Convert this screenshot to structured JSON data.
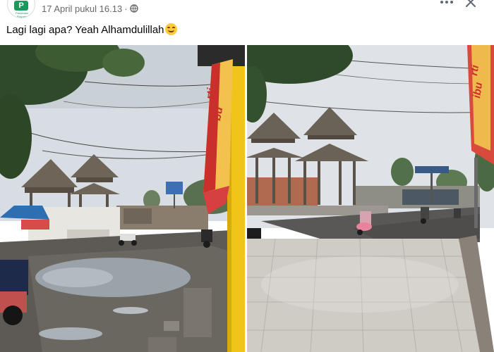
{
  "post": {
    "page_logo_text": "P",
    "page_logo_caption": "Pasundan Ekspres",
    "timestamp": "17 April pukul 16.13",
    "separator": "·",
    "privacy_icon": "globe-icon",
    "more_icon": "more-options-icon",
    "close_icon": "close-icon",
    "text": "Lagi lagi apa? Yeah Alhamdulillah",
    "emoji": "smiling-face-with-open-hands-emoji"
  },
  "photos": {
    "left": {
      "description_icon": "photo-street-potholes",
      "banner_text_1": "rti",
      "banner_text_2": "bu"
    },
    "right": {
      "description_icon": "photo-street-paved",
      "banner_text_1": "rti",
      "banner_text_2": "ibu"
    }
  },
  "colors": {
    "accent_green": "#1a9a5a",
    "meta_gray": "#65676b",
    "banner_red": "#c9302c",
    "banner_yellow": "#f2c14e"
  }
}
